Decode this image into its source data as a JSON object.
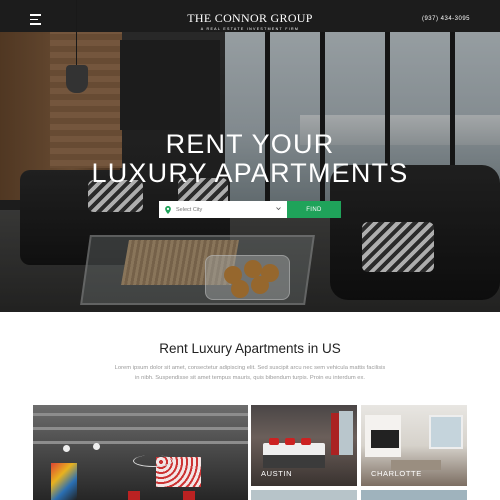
{
  "header": {
    "logo_title": "THE CONNOR GROUP",
    "logo_subtitle": "A REAL ESTATE INVESTMENT FIRM",
    "phone": "(937) 434-3095",
    "menu_icon": "hamburger-menu-icon"
  },
  "hero": {
    "title_line1": "RENT YOUR",
    "title_line2": "LUXURY APARTMENTS",
    "search": {
      "select_value": "Select City",
      "pin_icon": "location-pin-icon",
      "chevron_icon": "chevron-down-icon",
      "find_label": "FIND"
    }
  },
  "intro": {
    "title": "Rent Luxury Apartments in US",
    "text_line1": "Lorem ipsum dolor sit amet, consectetur adipiscing elit. Sed suscipit arcu nec sem vehicula mattis facilisis",
    "text_line2": "in nibh. Suspendisse sit amet tempus mauris, quis bibendum turpis. Proin eu interdum ex."
  },
  "gallery": {
    "tiles": [
      {
        "label": ""
      },
      {
        "label": "AUSTIN"
      },
      {
        "label": "CHARLOTTE"
      }
    ]
  },
  "colors": {
    "accent_green": "#1fa35a",
    "text_dark": "#222222",
    "text_muted": "#9a9a9a"
  }
}
